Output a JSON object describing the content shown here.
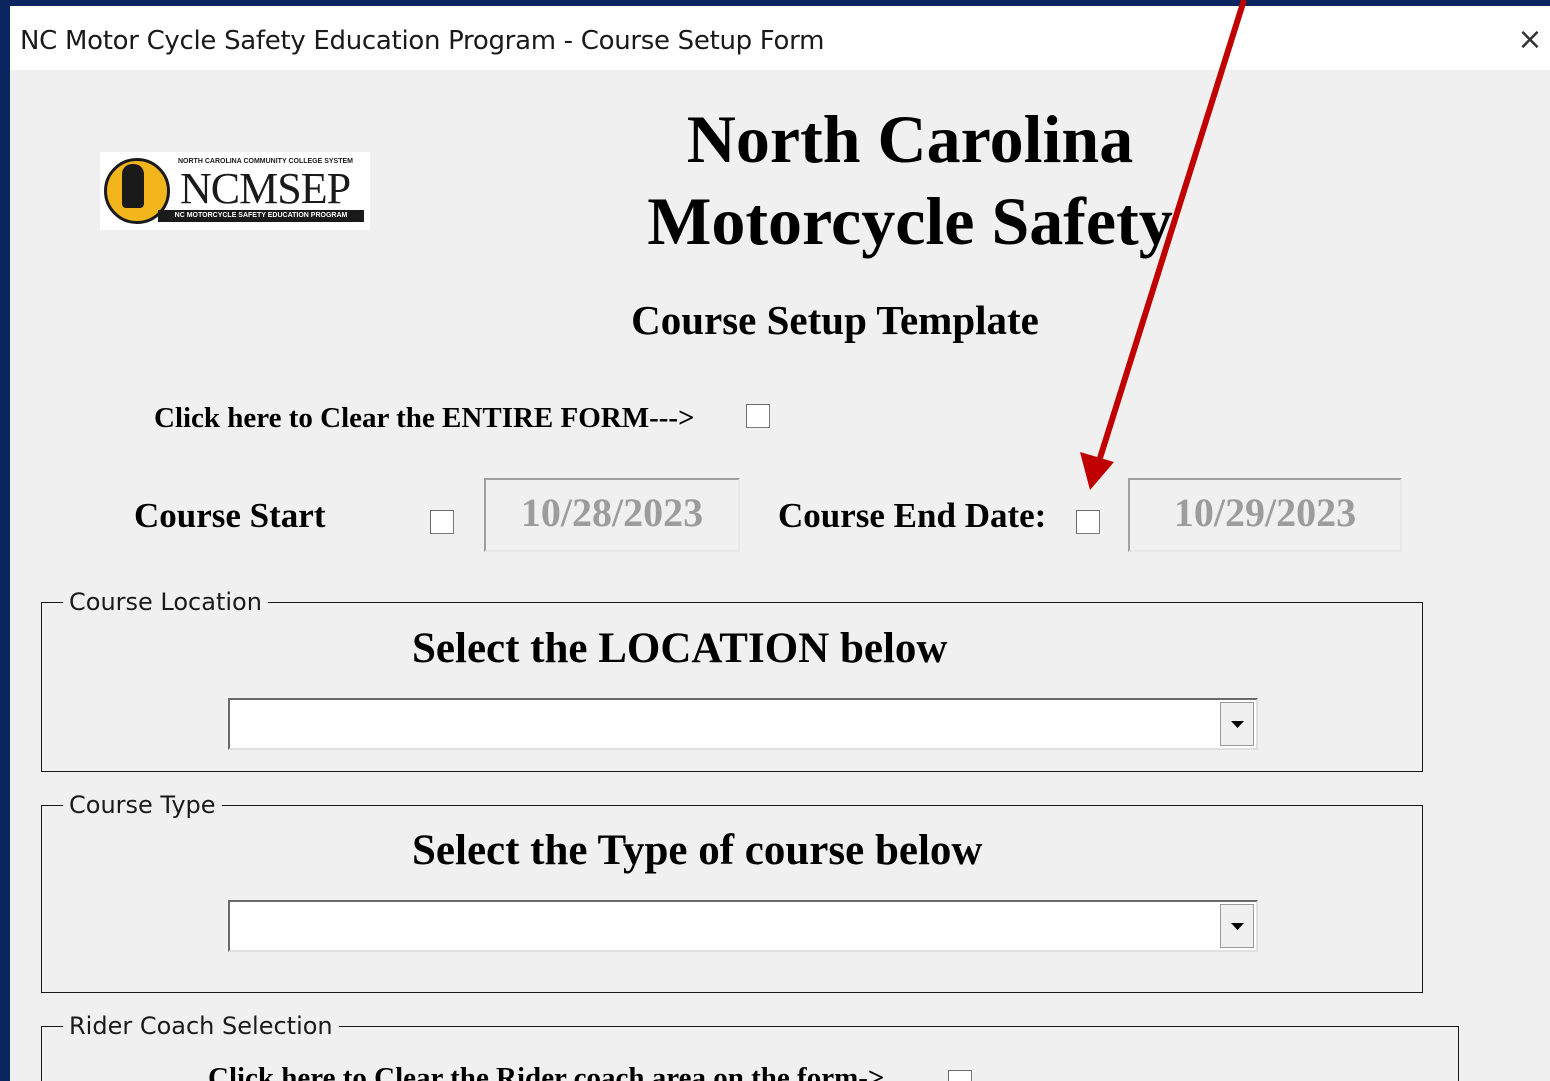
{
  "window": {
    "title": "NC Motor Cycle Safety Education Program - Course Setup Form",
    "close_glyph": "×"
  },
  "logo": {
    "top_text": "NORTH CAROLINA COMMUNITY COLLEGE SYSTEM",
    "main_text": "NCMSEP",
    "bottom_text": "NC MOTORCYCLE SAFETY EDUCATION PROGRAM"
  },
  "header": {
    "title_line1": "North Carolina",
    "title_line2": "Motorcycle Safety",
    "subtitle": "Course Setup Template"
  },
  "clear_form": {
    "label": "Click here to Clear the ENTIRE FORM--->",
    "checked": false
  },
  "dates": {
    "start_label": "Course Start",
    "start_value": "10/28/2023",
    "start_checked": false,
    "end_label": "Course End Date:",
    "end_value": "10/29/2023",
    "end_checked": false
  },
  "location_group": {
    "legend": "Course Location",
    "heading": "Select the LOCATION below",
    "selected_value": ""
  },
  "type_group": {
    "legend": "Course Type",
    "heading": "Select the Type of course below",
    "selected_value": ""
  },
  "rider_coach_group": {
    "legend": "Rider Coach Selection",
    "clear_label": "Click here to Clear the Rider coach area on the form->"
  },
  "colors": {
    "background": "#0b2560",
    "form": "#f0f0f0",
    "annotation_arrow": "#c00000",
    "disabled_text": "#9c9c9c"
  },
  "icons": {
    "close": "close-icon",
    "dropdown": "chevron-down-icon",
    "annotation": "arrow-annotation-icon"
  }
}
